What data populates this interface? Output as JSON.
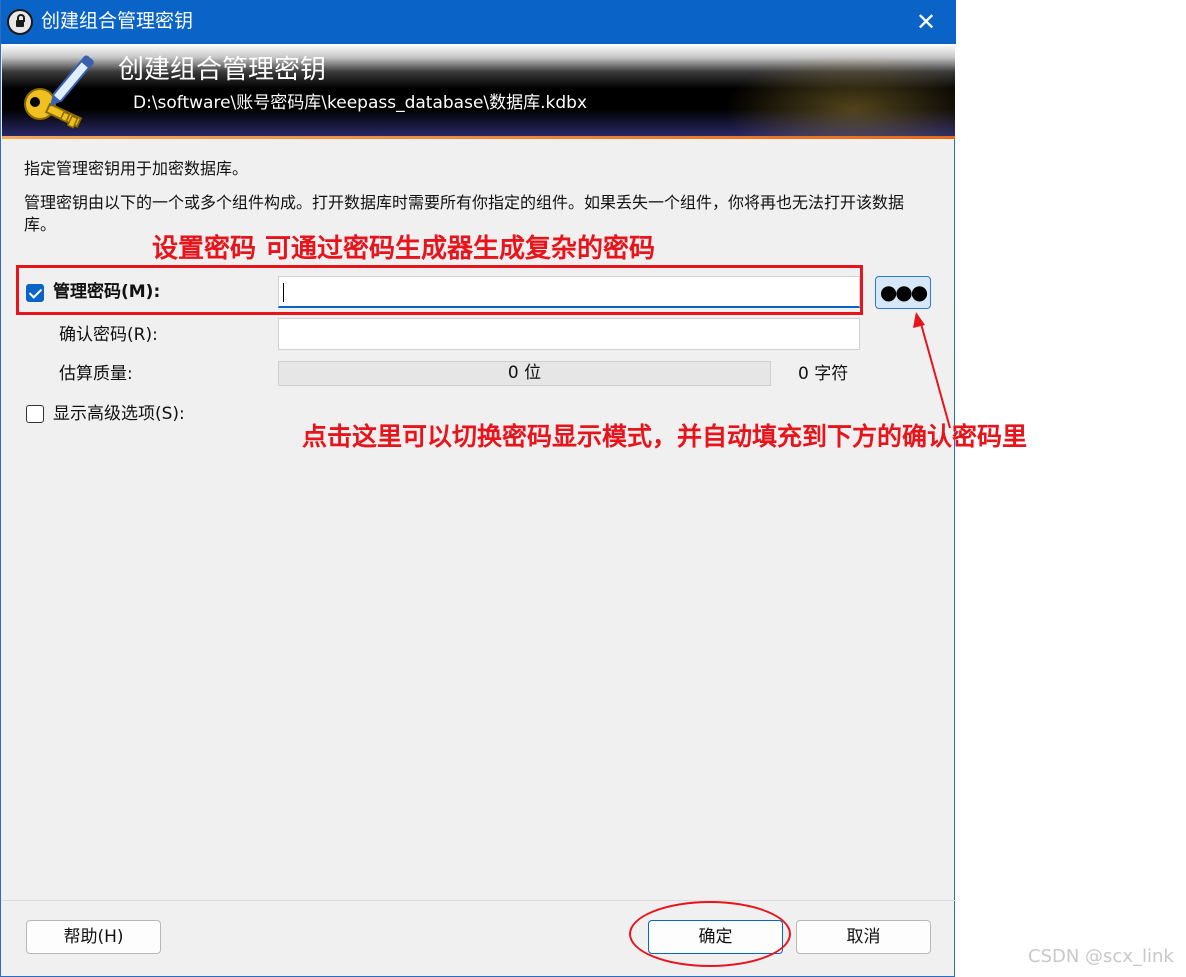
{
  "window": {
    "title": "创建组合管理密钥",
    "close_glyph": "✕",
    "app_icon": "lock-icon"
  },
  "banner": {
    "title": "创建组合管理密钥",
    "path": "D:\\software\\账号密码库\\keepass_database\\数据库.kdbx",
    "icon": "key-pen-icon"
  },
  "intro": "指定管理密钥用于加密数据库。",
  "description": "管理密钥由以下的一个或多个组件构成。打开数据库时需要所有你指定的组件。如果丢失一个组件，你将再也无法打开该数据库。",
  "master_password": {
    "checked": true,
    "label": "管理密码(M):",
    "value": "",
    "toggle_label": "●●●"
  },
  "confirm_password": {
    "label": "确认密码(R):",
    "value": ""
  },
  "quality": {
    "label": "估算质量:",
    "bits_text": "0 位",
    "chars_text": "0 字符",
    "percent": 0
  },
  "advanced": {
    "checked": false,
    "label": "显示高级选项(S):"
  },
  "buttons": {
    "help": "帮助(H)",
    "ok": "确定",
    "cancel": "取消"
  },
  "annotations": {
    "top": "设置密码 可通过密码生成器生成复杂的密码",
    "right": "点击这里可以切换密码显示模式，并自动填充到下方的确认密码里",
    "color": "#e8141c"
  },
  "watermark": "CSDN @scx_link",
  "colors": {
    "accent": "#0a64c8",
    "banner_stripe": "#e86a18"
  }
}
